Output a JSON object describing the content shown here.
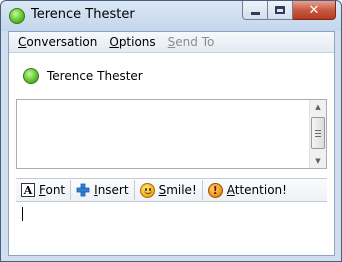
{
  "window": {
    "title": "Terence Thester",
    "status_color": "#4cb82a"
  },
  "menu": {
    "items": [
      {
        "label": "Conversation",
        "accel": "C",
        "rest": "onversation",
        "enabled": true
      },
      {
        "label": "Options",
        "accel": "O",
        "rest": "ptions",
        "enabled": true
      },
      {
        "label": "Send To",
        "accel": "S",
        "rest": "end To",
        "enabled": false
      }
    ]
  },
  "contact": {
    "name": "Terence Thester",
    "status_icon": "online-status-icon"
  },
  "toolbar": {
    "font_accel": "F",
    "font_rest": "ont",
    "insert_accel": "I",
    "insert_rest": "nsert",
    "smile_accel": "S",
    "smile_rest": "mile!",
    "attention_accel": "A",
    "attention_rest": "ttention!"
  },
  "icons": {
    "font": "font-icon",
    "insert": "plus-icon",
    "smile": "smiley-icon",
    "attention": "attention-icon"
  }
}
